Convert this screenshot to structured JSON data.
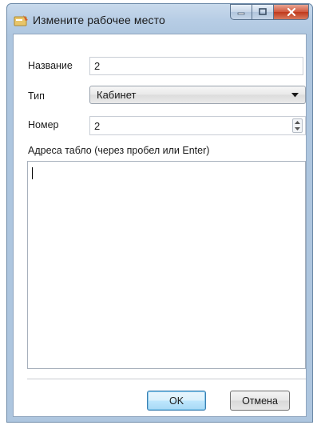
{
  "window": {
    "title": "Измените рабочее место",
    "icon": "workplace-icon"
  },
  "form": {
    "name": {
      "label": "Название",
      "value": "2"
    },
    "type": {
      "label": "Тип",
      "selected": "Кабинет"
    },
    "number": {
      "label": "Номер",
      "value": "2"
    },
    "addresses": {
      "label": "Адреса табло (через пробел или Enter)",
      "value": ""
    }
  },
  "buttons": {
    "ok": "OK",
    "cancel": "Отмена"
  },
  "colors": {
    "title_bar": "#b7cde5",
    "close_button": "#c0391c",
    "default_button": "#bee6fd"
  }
}
